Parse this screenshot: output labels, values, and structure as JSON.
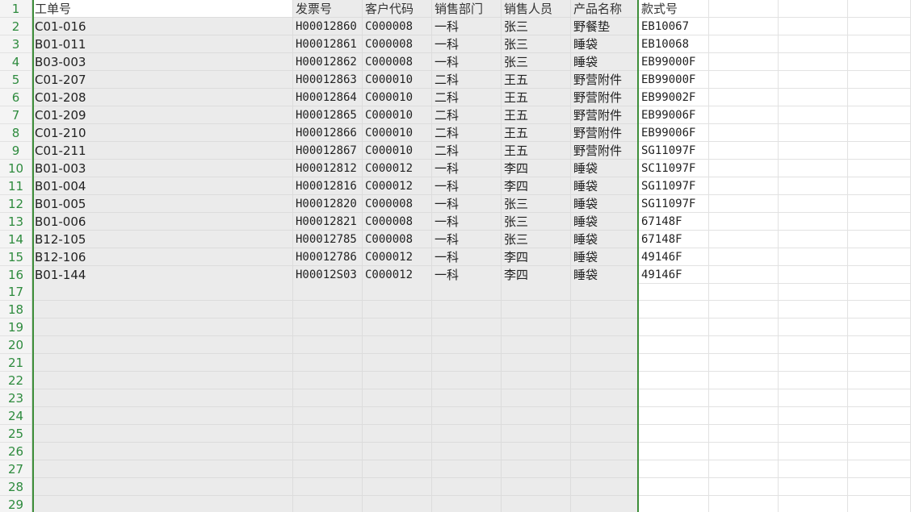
{
  "sheet": {
    "row_numbers": [
      "1",
      "2",
      "3",
      "4",
      "5",
      "6",
      "7",
      "8",
      "9",
      "10",
      "11",
      "12",
      "13",
      "14",
      "15",
      "16",
      "17",
      "18",
      "19",
      "20",
      "21",
      "22",
      "23",
      "24",
      "25",
      "26",
      "27",
      "28",
      "29"
    ],
    "headers": [
      "工单号",
      "发票号",
      "客户代码",
      "销售部门",
      "销售人员",
      "产品名称",
      "款式号"
    ],
    "rows": [
      [
        "C01-016",
        "H00012860",
        "C000008",
        "一科",
        "张三",
        "野餐垫",
        "EB10067"
      ],
      [
        "B01-011",
        "H00012861",
        "C000008",
        "一科",
        "张三",
        "睡袋",
        "EB10068"
      ],
      [
        "B03-003",
        "H00012862",
        "C000008",
        "一科",
        "张三",
        "睡袋",
        "EB99000F"
      ],
      [
        "C01-207",
        "H00012863",
        "C000010",
        "二科",
        "王五",
        "野营附件",
        "EB99000F"
      ],
      [
        "C01-208",
        "H00012864",
        "C000010",
        "二科",
        "王五",
        "野营附件",
        "EB99002F"
      ],
      [
        "C01-209",
        "H00012865",
        "C000010",
        "二科",
        "王五",
        "野营附件",
        "EB99006F"
      ],
      [
        "C01-210",
        "H00012866",
        "C000010",
        "二科",
        "王五",
        "野营附件",
        "EB99006F"
      ],
      [
        "C01-211",
        "H00012867",
        "C000010",
        "二科",
        "王五",
        "野营附件",
        "SG11097F"
      ],
      [
        "B01-003",
        "H00012812",
        "C000012",
        "一科",
        "李四",
        "睡袋",
        "SC11097F"
      ],
      [
        "B01-004",
        "H00012816",
        "C000012",
        "一科",
        "李四",
        "睡袋",
        "SG11097F"
      ],
      [
        "B01-005",
        "H00012820",
        "C000008",
        "一科",
        "张三",
        "睡袋",
        "SG11097F"
      ],
      [
        "B01-006",
        "H00012821",
        "C000008",
        "一科",
        "张三",
        "睡袋",
        "67148F"
      ],
      [
        "B12-105",
        "H00012785",
        "C000008",
        "一科",
        "张三",
        "睡袋",
        "67148F"
      ],
      [
        "B12-106",
        "H00012786",
        "C000012",
        "一科",
        "李四",
        "睡袋",
        "49146F"
      ],
      [
        "B01-144",
        "H00012S03",
        "C000012",
        "一科",
        "李四",
        "睡袋",
        "49146F"
      ]
    ]
  }
}
